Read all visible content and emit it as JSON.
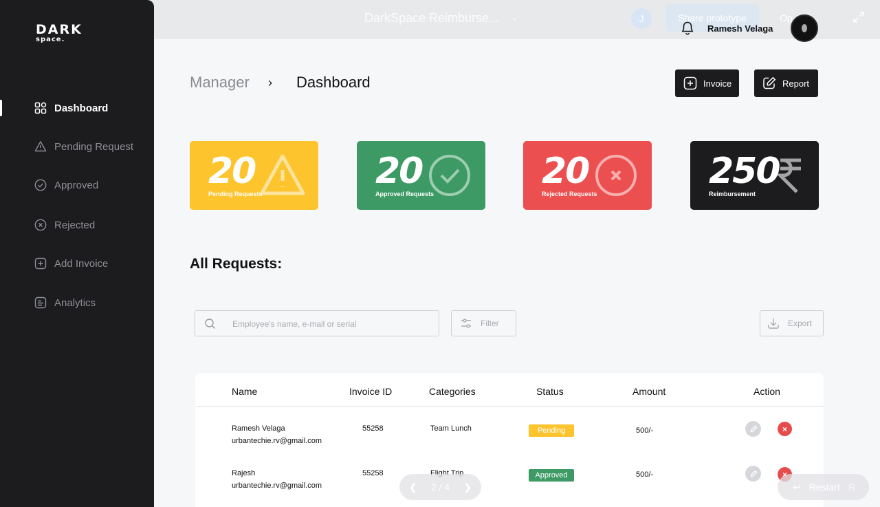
{
  "prototype_bar": {
    "title": "DarkSpace Reimburse...",
    "avatar_initial": "J",
    "share_label": "Share prototype",
    "options_label": "Op",
    "pager": {
      "current": "2 / 4"
    },
    "restart_label": "Restart",
    "restart_key": "R"
  },
  "brand": {
    "line1": "DARK",
    "line2": "space."
  },
  "sidebar": {
    "items": [
      {
        "label": "Dashboard",
        "icon": "grid-icon",
        "active": true
      },
      {
        "label": "Pending Request",
        "icon": "warning-icon"
      },
      {
        "label": "Approved",
        "icon": "check-circle-icon"
      },
      {
        "label": "Rejected",
        "icon": "x-circle-icon"
      },
      {
        "label": "Add Invoice",
        "icon": "plus-square-icon"
      },
      {
        "label": "Analytics",
        "icon": "document-icon"
      }
    ]
  },
  "user": {
    "name": "Ramesh Velaga"
  },
  "breadcrumb": {
    "parent": "Manager",
    "separator": "›",
    "current": "Dashboard"
  },
  "actions": {
    "invoice_label": "Invoice",
    "report_label": "Report"
  },
  "stats": [
    {
      "value": "20",
      "label": "Pending Requests",
      "color": "#fdc42d",
      "icon": "warning-icon"
    },
    {
      "value": "20",
      "label": "Approved Requests",
      "color": "#3d9a65",
      "icon": "check-circle-icon"
    },
    {
      "value": "20",
      "label": "Rejected Requests",
      "color": "#ec4f4f",
      "icon": "x-circle-icon"
    },
    {
      "value": "250",
      "label": "Reimbursement",
      "color": "#1c1c1f",
      "icon": "rupee-icon"
    }
  ],
  "requests": {
    "title": "All Requests:",
    "search_placeholder": "Employee's name, e-mail or serial",
    "filter_label": "Filter",
    "export_label": "Export",
    "columns": [
      "Name",
      "Invoice ID",
      "Categories",
      "Status",
      "Amount",
      "Action"
    ],
    "rows": [
      {
        "name": "Ramesh Velaga",
        "email": "urbantechie.rv@gmail.com",
        "invoice_id": "55258",
        "category": "Team Lunch",
        "status": "Pending",
        "status_color": "#fdc42d",
        "amount": "500/-"
      },
      {
        "name": "Rajesh",
        "email": "urbantechie.rv@gmail.com",
        "invoice_id": "55258",
        "category": "Flight Trip",
        "status": "Approved",
        "status_color": "#3d9a65",
        "amount": "500/-"
      }
    ]
  }
}
